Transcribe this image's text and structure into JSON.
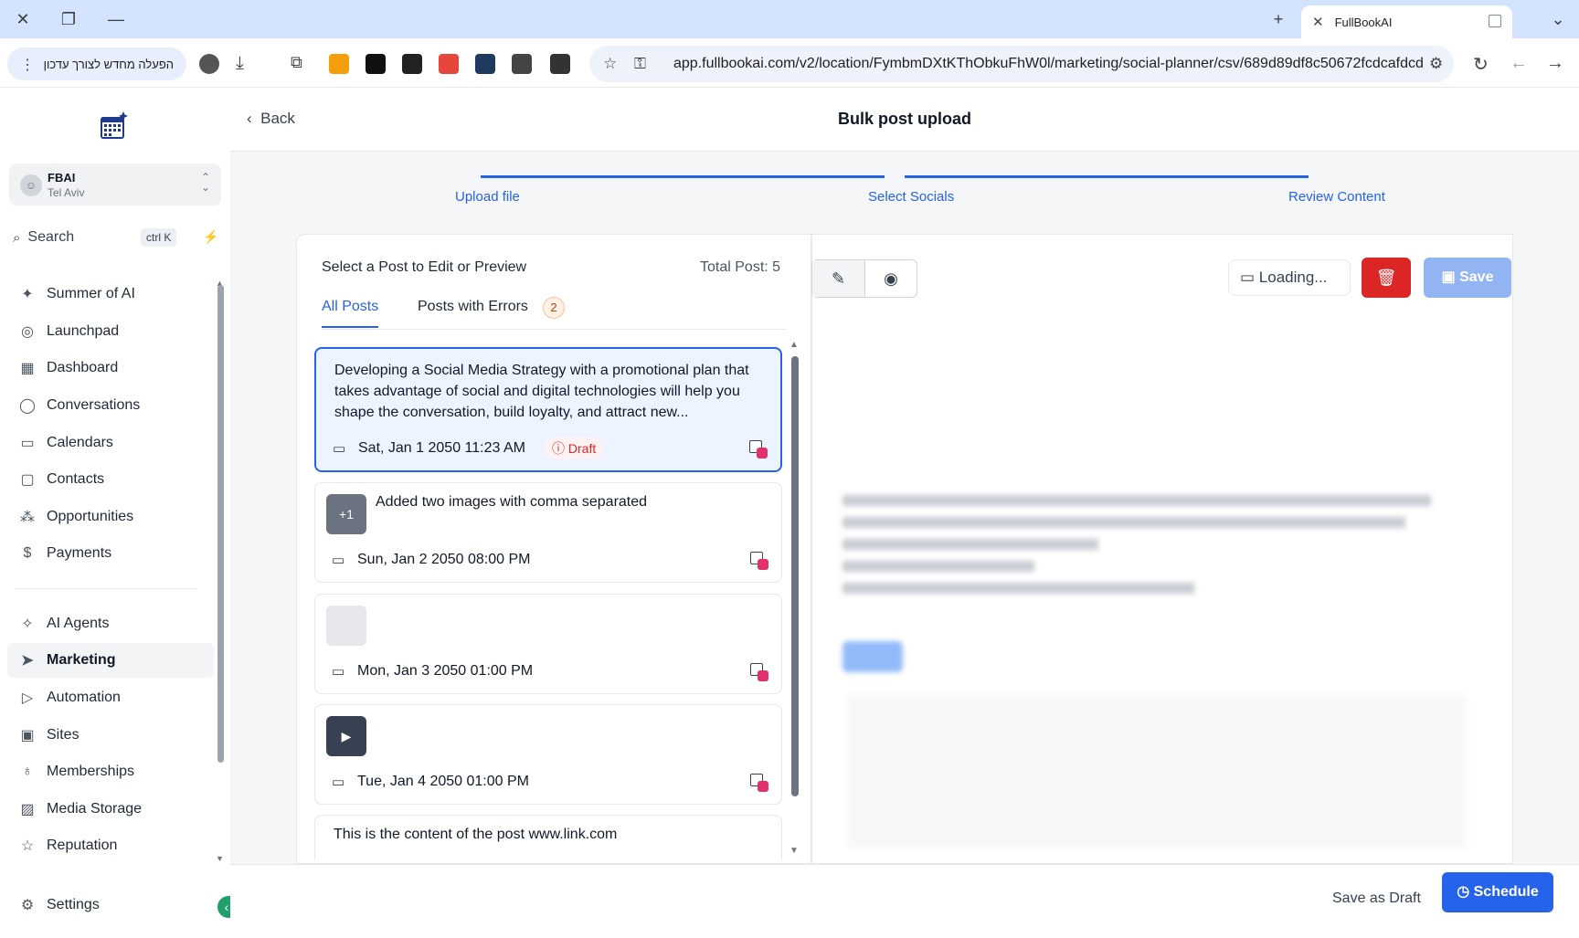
{
  "browser": {
    "tab_title": "FullBookAI",
    "menu_chip": "הפעלה מחדש לצורך עדכון",
    "url": "app.fullbookai.com/v2/location/FymbmDXtKThObkuFhW0l/marketing/social-planner/csv/689d89df8c50672fcdcafdcd"
  },
  "sidebar": {
    "location_name": "FBAI",
    "location_city": "Tel Aviv",
    "search_label": "Search",
    "search_shortcut": "ctrl K",
    "items": [
      {
        "label": "Summer of AI",
        "icon": "sparkle-icon"
      },
      {
        "label": "Launchpad",
        "icon": "launchpad-icon"
      },
      {
        "label": "Dashboard",
        "icon": "dashboard-icon"
      },
      {
        "label": "Conversations",
        "icon": "chat-icon"
      },
      {
        "label": "Calendars",
        "icon": "calendar-icon"
      },
      {
        "label": "Contacts",
        "icon": "contacts-icon"
      },
      {
        "label": "Opportunities",
        "icon": "opportunities-icon"
      },
      {
        "label": "Payments",
        "icon": "payments-icon"
      },
      {
        "label": "AI Agents",
        "icon": "ai-agents-icon"
      },
      {
        "label": "Marketing",
        "icon": "send-icon"
      },
      {
        "label": "Automation",
        "icon": "automation-icon"
      },
      {
        "label": "Sites",
        "icon": "sites-icon"
      },
      {
        "label": "Memberships",
        "icon": "memberships-icon"
      },
      {
        "label": "Media Storage",
        "icon": "media-icon"
      },
      {
        "label": "Reputation",
        "icon": "star-icon"
      }
    ],
    "settings_label": "Settings"
  },
  "header": {
    "back_label": "Back",
    "title": "Bulk post upload"
  },
  "steps": [
    "Upload file",
    "Select Socials",
    "Review Content"
  ],
  "list": {
    "heading": "Select a Post to Edit or Preview",
    "total": "Total Post: 5",
    "tab_all": "All Posts",
    "tab_errors": "Posts with Errors",
    "error_count": "2",
    "posts": [
      {
        "text": "Developing a Social Media Strategy with a promotional plan that takes advantage of social and digital technologies will help you shape the conversation, build loyalty, and attract new...",
        "date": "Sat, Jan 1 2050 11:23 AM",
        "status": "Draft"
      },
      {
        "thumb": "+1",
        "text": "Added two images with comma separated",
        "date": "Sun, Jan 2 2050 08:00 PM"
      },
      {
        "date": "Mon, Jan 3 2050 01:00 PM"
      },
      {
        "date": "Tue, Jan 4 2050 01:00 PM"
      },
      {
        "text": "This is the content of the post www.link.com"
      }
    ]
  },
  "editor": {
    "loading_label": "Loading...",
    "save_label": "Save",
    "draft_label": "Save as Draft",
    "schedule_label": "Schedule"
  },
  "colors": {
    "accent": "#2563eb",
    "danger": "#dc2626",
    "chrome": "#d3e3fd"
  }
}
